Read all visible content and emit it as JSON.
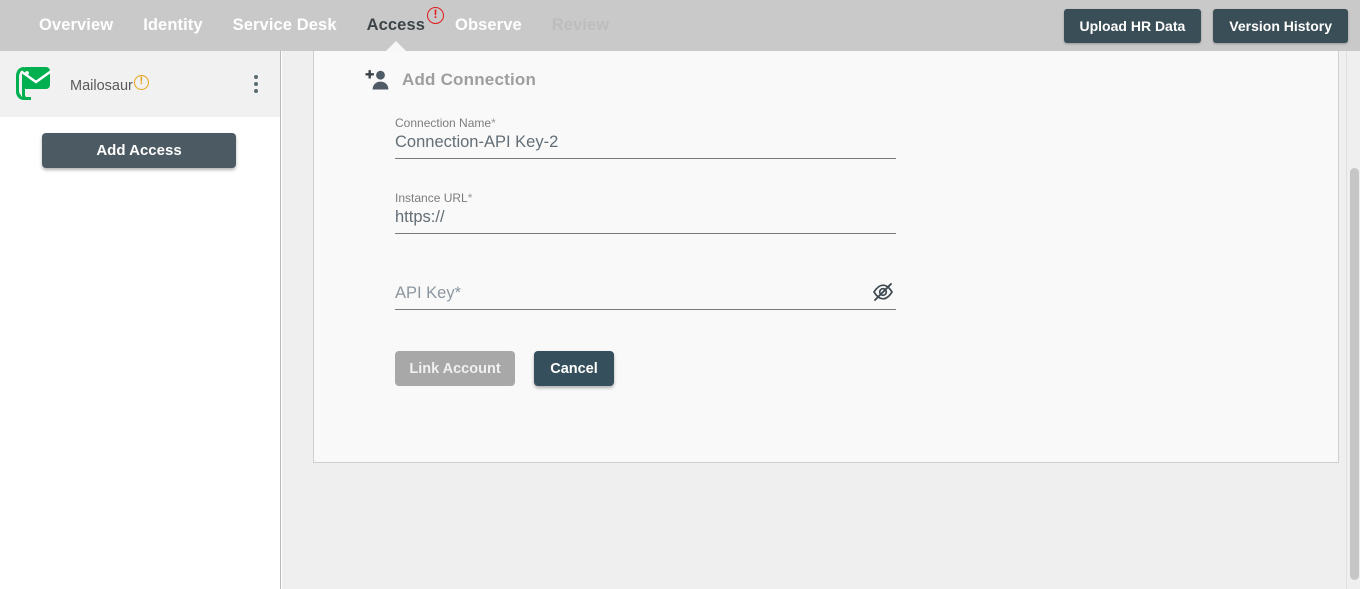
{
  "topnav": {
    "tabs": [
      {
        "label": "Overview",
        "state": "default",
        "badge": null
      },
      {
        "label": "Identity",
        "state": "default",
        "badge": null
      },
      {
        "label": "Service Desk",
        "state": "default",
        "badge": null
      },
      {
        "label": "Access",
        "state": "active",
        "badge": "!"
      },
      {
        "label": "Observe",
        "state": "default",
        "badge": null
      },
      {
        "label": "Review",
        "state": "muted",
        "badge": null
      }
    ],
    "upload_hr_data_label": "Upload HR Data",
    "version_history_label": "Version History",
    "bg_color": "#c9c9c9",
    "button_color": "#3a4e57",
    "badge_color": "#e21b1b"
  },
  "sidebar": {
    "org": {
      "name": "Mailosaur",
      "logo_icon": "mailosaur-envelope-logo",
      "logo_color": "#00b050",
      "warning_badge": "!",
      "warning_color": "#e8a317",
      "menu_icon": "kebab-menu-icon"
    },
    "add_access_label": "Add Access",
    "add_access_color": "#4c5a63"
  },
  "main": {
    "card": {
      "header_icon": "person-add-icon",
      "title": "Add Connection",
      "fields": [
        {
          "label": "Connection Name",
          "required_mark": "*",
          "value": "Connection-API Key-2",
          "placeholder": "",
          "name": "connection-name"
        },
        {
          "label": "Instance URL",
          "required_mark": "*",
          "value": "https://",
          "placeholder": "",
          "name": "instance-url"
        },
        {
          "label": "API Key",
          "required_mark": "*",
          "value": "",
          "placeholder": "API Key*",
          "name": "api-key",
          "toggle_icon": "eye-off-icon"
        }
      ],
      "link_account_label": "Link Account",
      "link_account_disabled": true,
      "cancel_label": "Cancel",
      "cancel_color": "#35505c",
      "disabled_color": "#a8a8a8"
    }
  },
  "scrollbar": {
    "name": "vertical-scrollbar",
    "thumb_color": "#c6c6c6"
  }
}
